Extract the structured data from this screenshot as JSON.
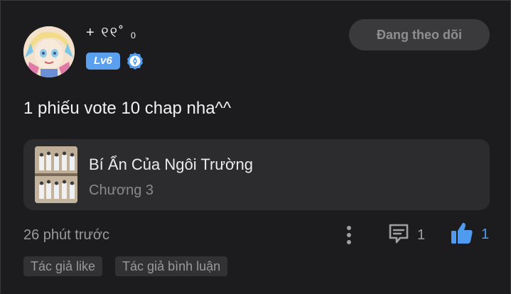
{
  "user": {
    "name": "+ ୧୧˚ ₀",
    "level": "Lv6",
    "follow_label": "Đang theo dõi"
  },
  "comment": {
    "text": "1 phiếu vote 10 chap nha^^",
    "time": "26 phút trước"
  },
  "story": {
    "title": "Bí Ẩn Của Ngôi Trường",
    "chapter": "Chương 3"
  },
  "actions": {
    "reply_count": "1",
    "like_count": "1"
  },
  "tags": [
    "Tác giả like",
    "Tác giả bình luận"
  ],
  "colors": {
    "background": "#1c1c1e",
    "card": "#2c2c2e",
    "accent": "#4f9bf0",
    "level_badge": "#5aa0ee"
  },
  "icons": {
    "certification": "certified-pen-icon",
    "more": "more-vertical-icon",
    "reply": "comment-icon",
    "like": "thumbs-up-icon"
  }
}
